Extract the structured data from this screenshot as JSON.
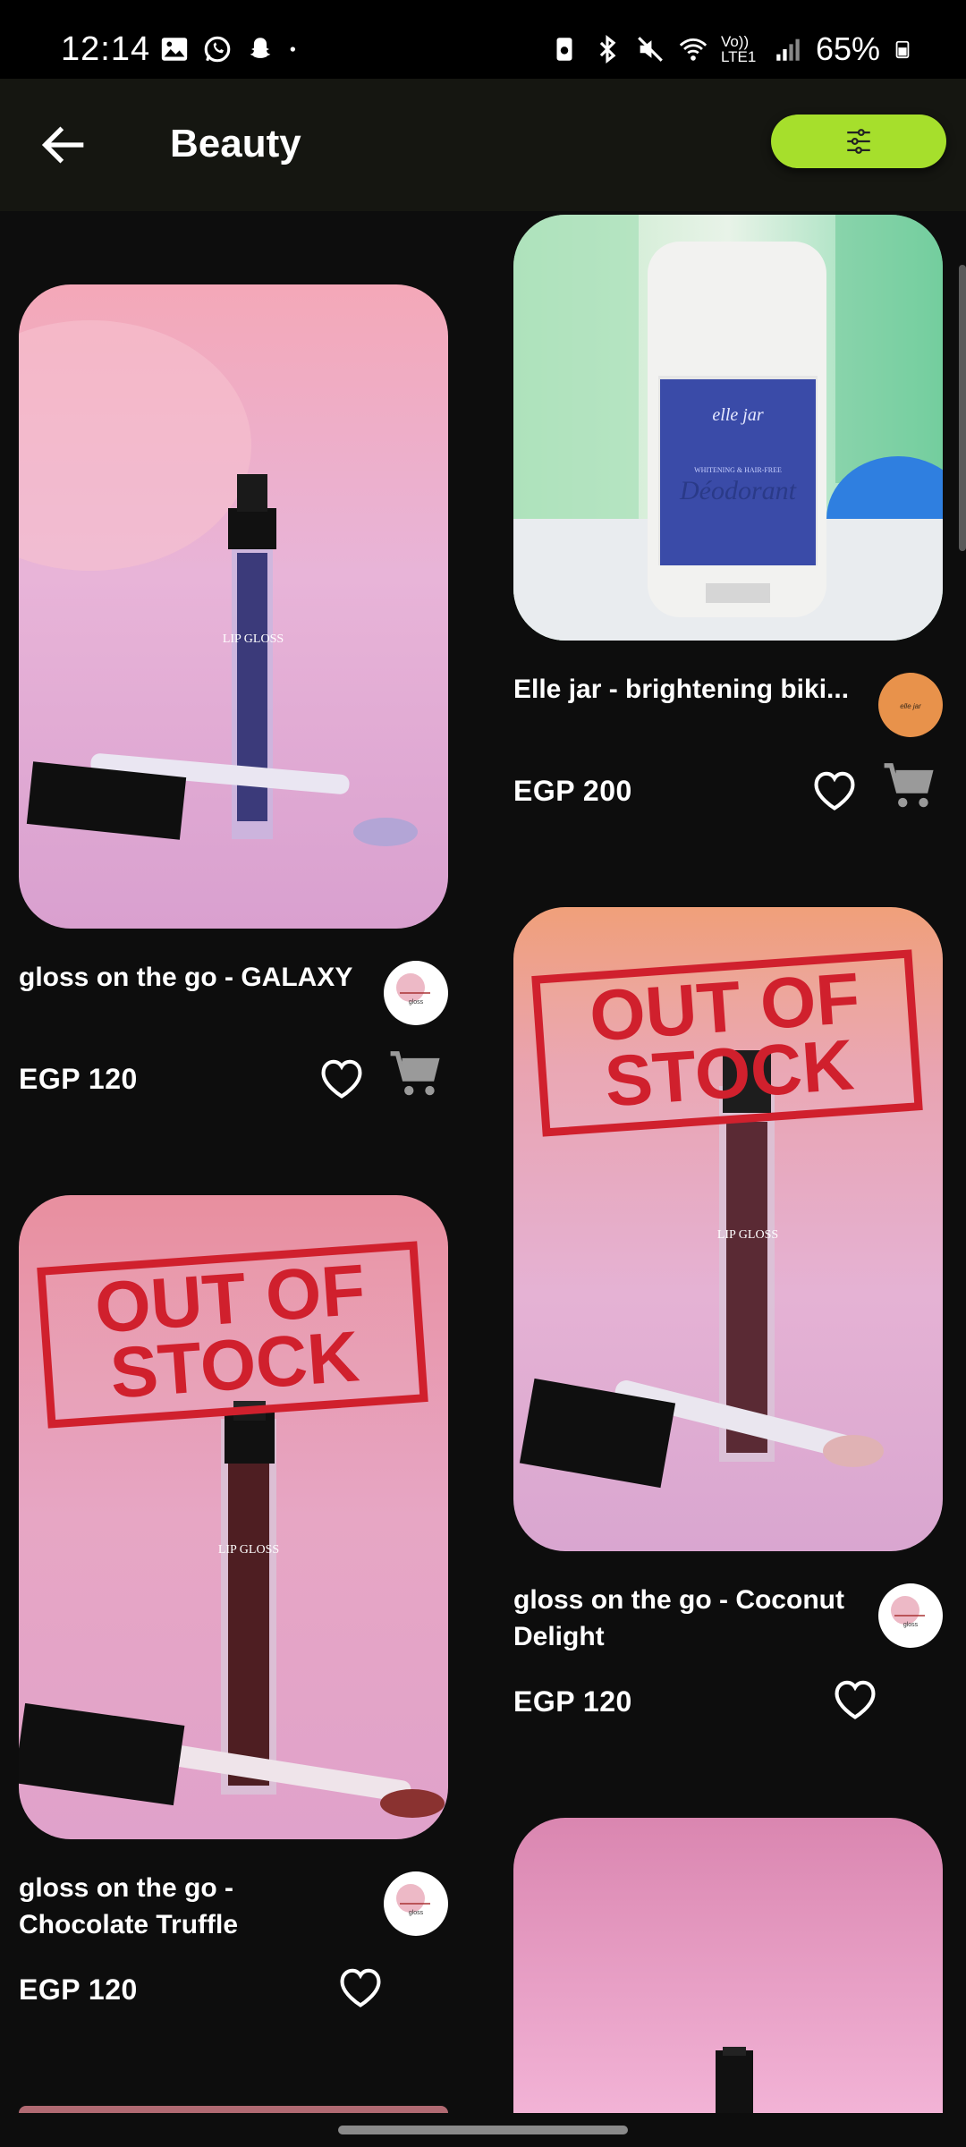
{
  "status_bar": {
    "time": "12:14",
    "battery": "65%",
    "network": "Vo)) LTE1"
  },
  "header": {
    "title": "Beauty"
  },
  "products": [
    {
      "name": "gloss on the go - GALAXY",
      "price": "EGP 120",
      "out_of_stock": false,
      "has_cart": true
    },
    {
      "name": "Elle jar - brightening biki...",
      "price": "EGP 200",
      "out_of_stock": false,
      "has_cart": true
    },
    {
      "name": "gloss on the go - Coconut Delight",
      "price": "EGP 120",
      "out_of_stock": true,
      "stamp": "OUT OF STOCK",
      "has_cart": false
    },
    {
      "name": "gloss on the go - Chocolate Truffle",
      "price": "EGP 120",
      "out_of_stock": true,
      "stamp": "OUT OF STOCK",
      "has_cart": false
    }
  ],
  "product_images": {
    "deodorant": {
      "brand": "elle jar",
      "line": "WHITENING & HAIR-FREE",
      "label": "Déodorant"
    },
    "lip_gloss": {
      "label": "LIP GLOSS"
    }
  },
  "colors": {
    "accent": "#a6df2c",
    "background": "#0d0d0d",
    "stamp": "#d0202d"
  },
  "icons": [
    "back-arrow-icon",
    "filter-sliders-icon",
    "heart-icon",
    "cart-icon"
  ]
}
